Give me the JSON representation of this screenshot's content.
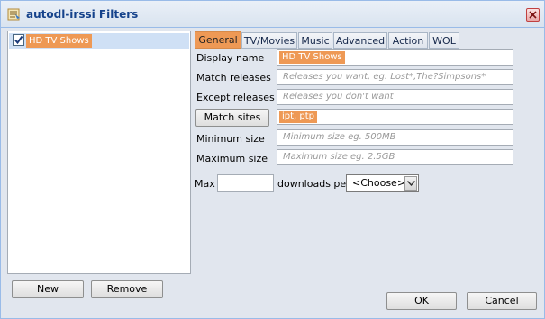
{
  "window": {
    "title": "autodl-irssi Filters",
    "icon": "filter-list-icon",
    "close_icon": "close-icon"
  },
  "filters": {
    "items": [
      {
        "name": "HD TV Shows",
        "checked": true
      }
    ],
    "new_label": "New",
    "remove_label": "Remove"
  },
  "tabs": [
    {
      "label": "General",
      "active": true
    },
    {
      "label": "TV/Movies",
      "active": false
    },
    {
      "label": "Music",
      "active": false
    },
    {
      "label": "Advanced",
      "active": false
    },
    {
      "label": "Action",
      "active": false
    },
    {
      "label": "WOL",
      "active": false
    }
  ],
  "general": {
    "display_name": {
      "label": "Display name",
      "value": "HD TV Shows"
    },
    "match_releases": {
      "label": "Match releases",
      "placeholder": "Releases you want, eg. Lost*,The?Simpsons*"
    },
    "except_releases": {
      "label": "Except releases",
      "placeholder": "Releases you don't want"
    },
    "match_sites": {
      "button_label": "Match sites",
      "value": "ipt, ptp"
    },
    "minimum_size": {
      "label": "Minimum size",
      "placeholder": "Minimum size eg. 500MB"
    },
    "maximum_size": {
      "label": "Maximum size",
      "placeholder": "Maximum size eg. 2.5GB"
    },
    "max_downloads": {
      "label_prefix": "Max",
      "value": "",
      "label_suffix": "downloads per",
      "per_selected": "<Choose>"
    }
  },
  "footer": {
    "ok_label": "OK",
    "cancel_label": "Cancel"
  },
  "colors": {
    "highlight": "#ee9955",
    "selection": "#cfe0f5",
    "title_text": "#15428b"
  }
}
